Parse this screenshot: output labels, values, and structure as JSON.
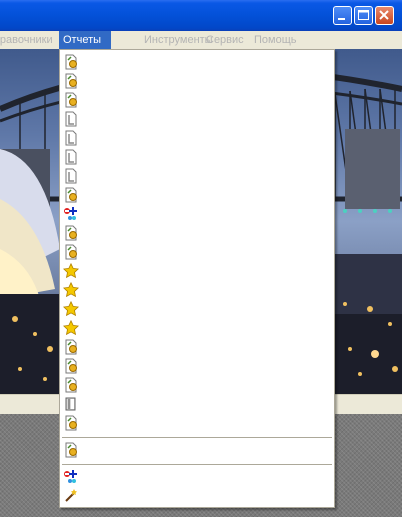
{
  "menubar": {
    "items": [
      {
        "label": "Справочники",
        "state": "dim"
      },
      {
        "label": "Отчеты",
        "state": "active"
      },
      {
        "label": "Инструменты",
        "state": "dim"
      },
      {
        "label": "Сервис",
        "state": "dim"
      },
      {
        "label": "Помощь",
        "state": "dim"
      }
    ]
  },
  "titlebar": {
    "buttons": [
      "minimize-icon",
      "maximize-icon",
      "close-icon"
    ]
  },
  "dropdown": {
    "items": [
      {
        "icon": "report-document-icon",
        "label": ""
      },
      {
        "icon": "report-document-icon",
        "label": ""
      },
      {
        "icon": "report-document-icon",
        "label": ""
      },
      {
        "icon": "document-gray-icon",
        "label": ""
      },
      {
        "icon": "document-gray-icon",
        "label": ""
      },
      {
        "icon": "document-gray-icon",
        "label": ""
      },
      {
        "icon": "document-gray-icon",
        "label": ""
      },
      {
        "icon": "report-document-icon",
        "label": ""
      },
      {
        "icon": "add-users-icon",
        "label": ""
      },
      {
        "icon": "report-document-icon",
        "label": ""
      },
      {
        "icon": "report-document-icon",
        "label": ""
      },
      {
        "icon": "star-icon",
        "label": ""
      },
      {
        "icon": "star-icon",
        "label": ""
      },
      {
        "icon": "star-icon",
        "label": ""
      },
      {
        "icon": "star-icon",
        "label": ""
      },
      {
        "icon": "report-document-icon",
        "label": ""
      },
      {
        "icon": "report-document-icon",
        "label": ""
      },
      {
        "icon": "report-document-icon",
        "label": ""
      },
      {
        "icon": "book-icon",
        "label": ""
      },
      {
        "icon": "report-document-icon",
        "label": ""
      },
      {
        "separator": true
      },
      {
        "icon": "report-document-icon",
        "label": ""
      },
      {
        "separator": true
      },
      {
        "icon": "add-users-icon",
        "label": ""
      },
      {
        "icon": "magic-wand-icon",
        "label": ""
      }
    ]
  },
  "colors": {
    "titlebar": "#0351d8",
    "menu_highlight": "#316ac5",
    "star": "#f4c800"
  }
}
